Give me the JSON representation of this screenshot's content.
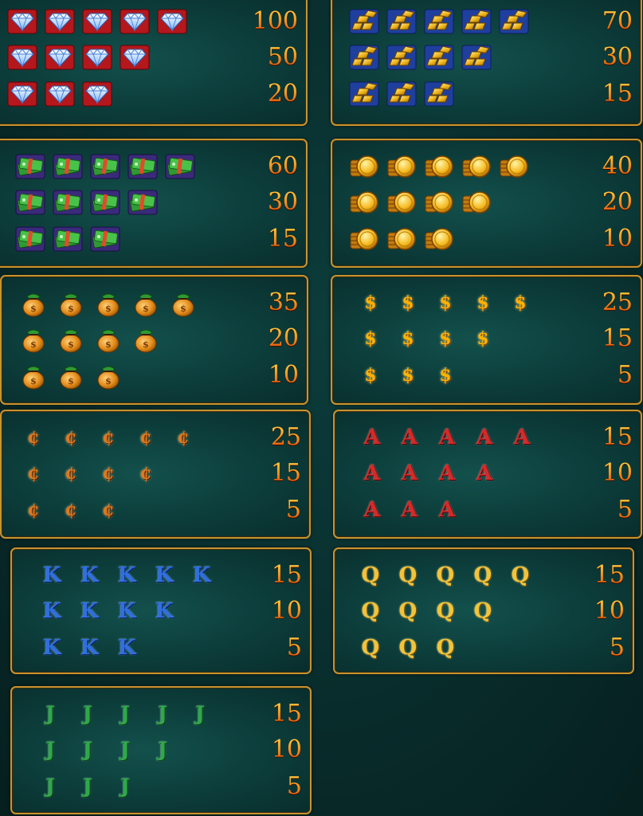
{
  "paytable": [
    {
      "symbol": "diamond",
      "icon": "diamond-icon",
      "payouts": [
        {
          "count": 5,
          "value": "100"
        },
        {
          "count": 4,
          "value": "50"
        },
        {
          "count": 3,
          "value": "20"
        }
      ]
    },
    {
      "symbol": "gold-bars",
      "icon": "gold-bars-icon",
      "payouts": [
        {
          "count": 5,
          "value": "70"
        },
        {
          "count": 4,
          "value": "30"
        },
        {
          "count": 3,
          "value": "15"
        }
      ]
    },
    {
      "symbol": "cash",
      "icon": "cash-stack-icon",
      "payouts": [
        {
          "count": 5,
          "value": "60"
        },
        {
          "count": 4,
          "value": "30"
        },
        {
          "count": 3,
          "value": "15"
        }
      ]
    },
    {
      "symbol": "coins",
      "icon": "coin-stack-icon",
      "payouts": [
        {
          "count": 5,
          "value": "40"
        },
        {
          "count": 4,
          "value": "20"
        },
        {
          "count": 3,
          "value": "10"
        }
      ]
    },
    {
      "symbol": "money-bag",
      "icon": "money-bag-icon",
      "payouts": [
        {
          "count": 5,
          "value": "35"
        },
        {
          "count": 4,
          "value": "20"
        },
        {
          "count": 3,
          "value": "10"
        }
      ]
    },
    {
      "symbol": "dollar",
      "icon": "dollar-sign-icon",
      "glyph": "$",
      "payouts": [
        {
          "count": 5,
          "value": "25"
        },
        {
          "count": 4,
          "value": "15"
        },
        {
          "count": 3,
          "value": "5"
        }
      ]
    },
    {
      "symbol": "cent",
      "icon": "cent-sign-icon",
      "glyph": "¢",
      "payouts": [
        {
          "count": 5,
          "value": "25"
        },
        {
          "count": 4,
          "value": "15"
        },
        {
          "count": 3,
          "value": "5"
        }
      ]
    },
    {
      "symbol": "ace",
      "icon": "letter-a-icon",
      "glyph": "A",
      "payouts": [
        {
          "count": 5,
          "value": "15"
        },
        {
          "count": 4,
          "value": "10"
        },
        {
          "count": 3,
          "value": "5"
        }
      ]
    },
    {
      "symbol": "king",
      "icon": "letter-k-icon",
      "glyph": "K",
      "payouts": [
        {
          "count": 5,
          "value": "15"
        },
        {
          "count": 4,
          "value": "10"
        },
        {
          "count": 3,
          "value": "5"
        }
      ]
    },
    {
      "symbol": "queen",
      "icon": "letter-q-icon",
      "glyph": "Q",
      "payouts": [
        {
          "count": 5,
          "value": "15"
        },
        {
          "count": 4,
          "value": "10"
        },
        {
          "count": 3,
          "value": "5"
        }
      ]
    },
    {
      "symbol": "jack",
      "icon": "letter-j-icon",
      "glyph": "J",
      "payouts": [
        {
          "count": 5,
          "value": "15"
        },
        {
          "count": 4,
          "value": "10"
        },
        {
          "count": 3,
          "value": "5"
        }
      ]
    }
  ],
  "colors": {
    "background": "#082b2a",
    "panel_border": "#c8932f",
    "payout_text": "#ff6a00"
  }
}
